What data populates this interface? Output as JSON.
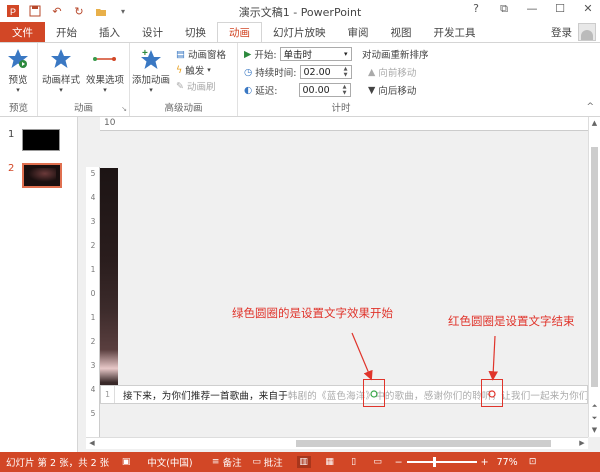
{
  "window": {
    "title": "演示文稿1 - PowerPoint",
    "controls": [
      "?",
      "⧉",
      "—",
      "☐",
      "✕"
    ]
  },
  "tabs": [
    {
      "label": "文件"
    },
    {
      "label": "开始"
    },
    {
      "label": "插入"
    },
    {
      "label": "设计"
    },
    {
      "label": "切换"
    },
    {
      "label": "动画"
    },
    {
      "label": "幻灯片放映"
    },
    {
      "label": "审阅"
    },
    {
      "label": "视图"
    },
    {
      "label": "开发工具"
    }
  ],
  "active_tab": "动画",
  "signin": "登录",
  "ribbon": {
    "preview": {
      "button": "预览",
      "group": "预览"
    },
    "animation": {
      "style_button": "动画样式",
      "effect_button": "效果选项",
      "group": "动画"
    },
    "advanced": {
      "add_button": "添加动画",
      "pane": "动画窗格",
      "trigger": "触发",
      "painter": "动画刷",
      "group": "高级动画"
    },
    "timing": {
      "start_label": "开始:",
      "start_value": "单击时",
      "duration_label": "持续时间:",
      "duration_value": "02.00",
      "delay_label": "延迟:",
      "delay_value": "00.00",
      "reorder_title": "对动画重新排序",
      "move_earlier": "向前移动",
      "move_later": "向后移动",
      "group": "计时"
    }
  },
  "slides": [
    {
      "number": "1"
    },
    {
      "number": "2"
    }
  ],
  "ruler": {
    "top_label": "10",
    "left_ticks": [
      "5",
      "4",
      "3",
      "2",
      "1",
      "0",
      "1",
      "2",
      "3",
      "4",
      "5"
    ]
  },
  "text_strip": {
    "line_number": "1",
    "text": "接下来，为你们推荐一首歌曲，来自于韩剧的《蓝色海洋》中的歌曲，感谢你们的聆听，让我们一起来为你们的回忆做准备",
    "text_lead": "接下来，为你们推荐一首歌曲，来自于",
    "text_faded": "韩剧的《蓝色海洋》中的歌曲，感谢你们的聆听，让我们一起来为你们的回忆做准备"
  },
  "annotations": {
    "green": "绿色圆圈的是设置文字效果开始",
    "red": "红色圆圈是设置文字结束"
  },
  "status": {
    "slide_info": "幻灯片 第 2 张，共 2 张",
    "language": "中文(中国)",
    "notes": "备注",
    "comments": "批注",
    "zoom": "77%",
    "zoom_level": 0.77
  },
  "colors": {
    "accent": "#D24726",
    "annotation": "#E0342B"
  }
}
